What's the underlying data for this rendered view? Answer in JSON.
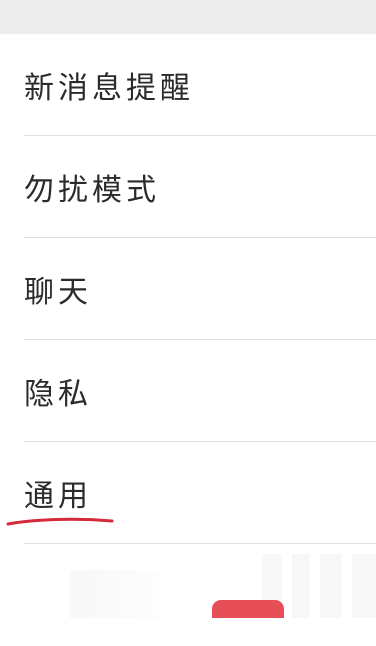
{
  "settings": {
    "items": [
      {
        "label": "新消息提醒"
      },
      {
        "label": "勿扰模式"
      },
      {
        "label": "聊天"
      },
      {
        "label": "隐私"
      },
      {
        "label": "通用"
      }
    ]
  },
  "annotation": {
    "underline_color": "#d42a3a",
    "highlight_color": "#e53b45"
  }
}
